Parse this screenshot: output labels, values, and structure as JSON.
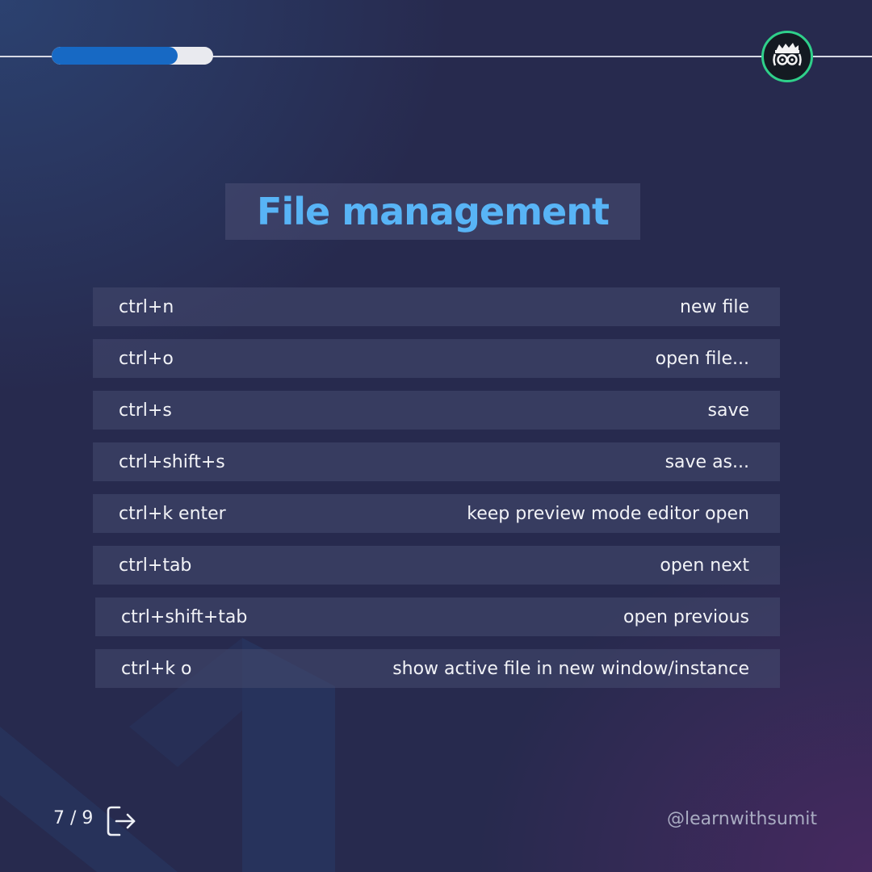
{
  "header": {
    "progress_fraction": 0.78,
    "accent_color": "#1769c4",
    "avatar_icon": "developer-glasses-icon"
  },
  "title": "File management",
  "shortcuts": [
    {
      "key": "ctrl+n",
      "action": "new file"
    },
    {
      "key": "ctrl+o",
      "action": "open file..."
    },
    {
      "key": "ctrl+s",
      "action": "save"
    },
    {
      "key": "ctrl+shift+s",
      "action": "save as..."
    },
    {
      "key": "ctrl+k enter",
      "action": "keep preview mode editor open"
    },
    {
      "key": "ctrl+tab",
      "action": "open next"
    },
    {
      "key": "ctrl+shift+tab",
      "action": "open previous"
    },
    {
      "key": "ctrl+k o",
      "action": "show active file in new window/instance"
    }
  ],
  "footer": {
    "page": "7 / 9",
    "next_icon": "next-arrow-icon",
    "handle": "@learnwithsumit"
  }
}
